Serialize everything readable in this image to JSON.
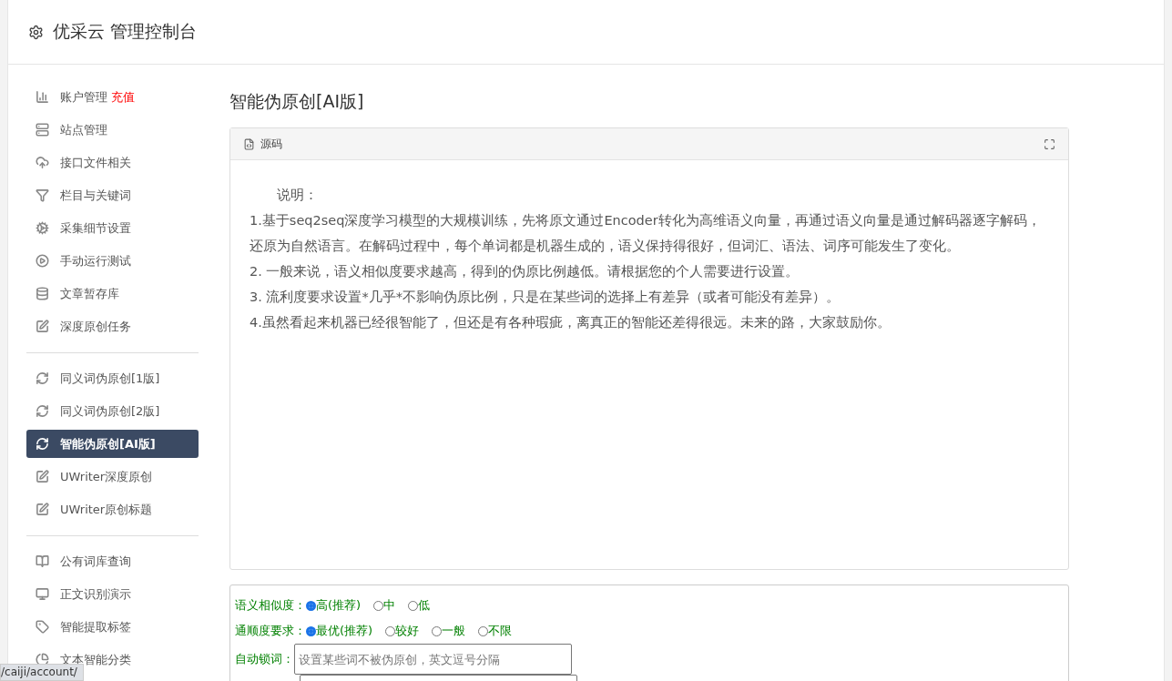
{
  "header": {
    "title": "优采云 管理控制台"
  },
  "sidebar": {
    "groups": [
      [
        {
          "label": "账户管理",
          "badge": "充值",
          "selected": false
        },
        {
          "label": "站点管理",
          "selected": false
        },
        {
          "label": "接口文件相关",
          "selected": false
        },
        {
          "label": "栏目与关键词",
          "selected": false
        },
        {
          "label": "采集细节设置",
          "selected": false
        },
        {
          "label": "手动运行测试",
          "selected": false
        },
        {
          "label": "文章暂存库",
          "selected": false
        },
        {
          "label": "深度原创任务",
          "selected": false
        }
      ],
      [
        {
          "label": "同义词伪原创[1版]",
          "selected": false
        },
        {
          "label": "同义词伪原创[2版]",
          "selected": false
        },
        {
          "label": "智能伪原创[AI版]",
          "selected": true
        },
        {
          "label": "UWriter深度原创",
          "selected": false
        },
        {
          "label": "UWriter原创标题",
          "selected": false
        }
      ],
      [
        {
          "label": "公有词库查询",
          "selected": false
        },
        {
          "label": "正文识别演示",
          "selected": false
        },
        {
          "label": "智能提取标签",
          "selected": false
        },
        {
          "label": "文本智能分类",
          "selected": false
        }
      ]
    ]
  },
  "content": {
    "title": "智能伪原创[AI版]",
    "editor": {
      "tab": "源码",
      "paragraphs": [
        "说明：",
        "1.基于seq2seq深度学习模型的大规模训练，先将原文通过Encoder转化为高维语义向量，再通过语义向量是通过解码器逐字解码，还原为自然语言。在解码过程中，每个单词都是机器生成的，语义保持得很好，但词汇、语法、词序可能发生了变化。",
        "2. 一般来说，语义相似度要求越高，得到的伪原比例越低。请根据您的个人需要进行设置。",
        "3. 流利度要求设置*几乎*不影响伪原比例，只是在某些词的选择上有差异（或者可能没有差异）。",
        "4.虽然看起来机器已经很智能了，但还是有各种瑕疵，离真正的智能还差得很远。未来的路，大家鼓励你。"
      ]
    },
    "options": [
      {
        "kind": "radio",
        "label": "语义相似度：",
        "choices": [
          {
            "label": "高(推荐)",
            "selected": true
          },
          {
            "label": "中",
            "selected": false
          },
          {
            "label": "低",
            "selected": false
          }
        ]
      },
      {
        "kind": "radio",
        "label": "通顺度要求：",
        "choices": [
          {
            "label": "最优(推荐)",
            "selected": true
          },
          {
            "label": "较好",
            "selected": false
          },
          {
            "label": "一般",
            "selected": false
          },
          {
            "label": "不限",
            "selected": false
          }
        ]
      },
      {
        "kind": "text",
        "label": "自动锁词：",
        "placeholder": "设置某些词不被伪原创，英文逗号分隔"
      },
      {
        "kind": "text"
      }
    ]
  },
  "status_url": "/caiji/account/"
}
